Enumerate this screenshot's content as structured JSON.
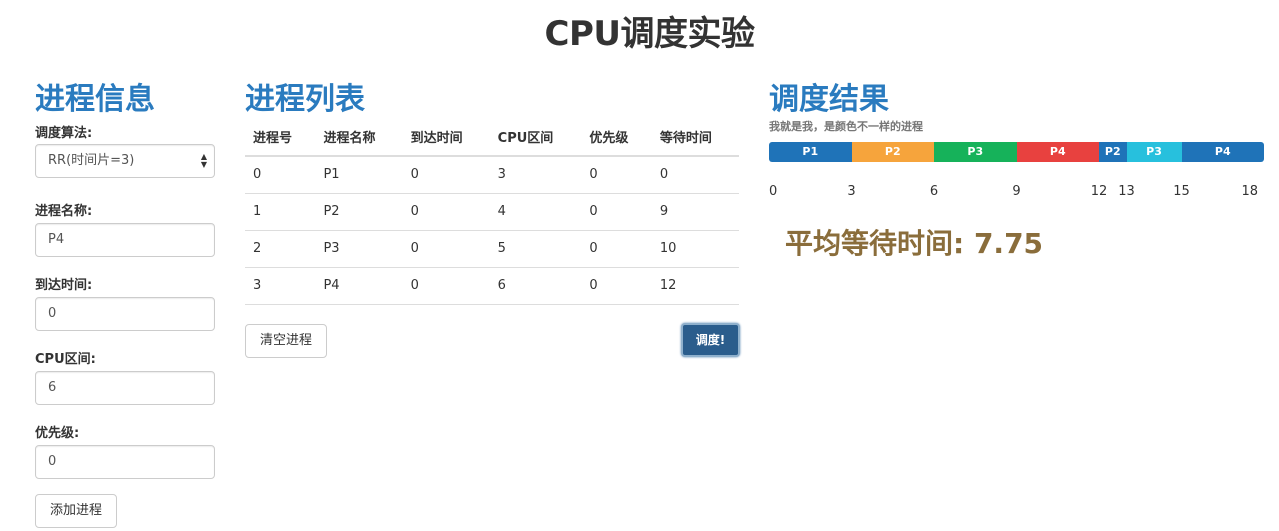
{
  "title": "CPU调度实验",
  "info": {
    "heading": "进程信息",
    "algorithm_label": "调度算法:",
    "algorithm_value": "RR(时间片=3)",
    "name_label": "进程名称:",
    "name_value": "P4",
    "arrival_label": "到达时间:",
    "arrival_value": "0",
    "burst_label": "CPU区间:",
    "burst_value": "6",
    "priority_label": "优先级:",
    "priority_value": "0",
    "add_button": "添加进程"
  },
  "list": {
    "heading": "进程列表",
    "columns": [
      "进程号",
      "进程名称",
      "到达时间",
      "CPU区间",
      "优先级",
      "等待时间"
    ],
    "rows": [
      [
        "0",
        "P1",
        "0",
        "3",
        "0",
        "0"
      ],
      [
        "1",
        "P2",
        "0",
        "4",
        "0",
        "9"
      ],
      [
        "2",
        "P3",
        "0",
        "5",
        "0",
        "10"
      ],
      [
        "3",
        "P4",
        "0",
        "6",
        "0",
        "12"
      ]
    ],
    "clear_button": "清空进程",
    "schedule_button": "调度!"
  },
  "result": {
    "heading": "调度结果",
    "hint": "我就是我，是颜色不一样的进程",
    "segments": [
      {
        "label": "P1",
        "start": 0,
        "end": 3,
        "color": "#1f73b8"
      },
      {
        "label": "P2",
        "start": 3,
        "end": 6,
        "color": "#f6a43c"
      },
      {
        "label": "P3",
        "start": 6,
        "end": 9,
        "color": "#16b25a"
      },
      {
        "label": "P4",
        "start": 9,
        "end": 12,
        "color": "#e8413f"
      },
      {
        "label": "P2",
        "start": 12,
        "end": 13,
        "color": "#1f73b8"
      },
      {
        "label": "P3",
        "start": 13,
        "end": 15,
        "color": "#27c0dd"
      },
      {
        "label": "P4",
        "start": 15,
        "end": 18,
        "color": "#1f73b8"
      }
    ],
    "ticks": [
      "0",
      "3",
      "6",
      "9",
      "12",
      "13",
      "15",
      "18"
    ],
    "avg_wait": "平均等待时间: 7.75"
  }
}
